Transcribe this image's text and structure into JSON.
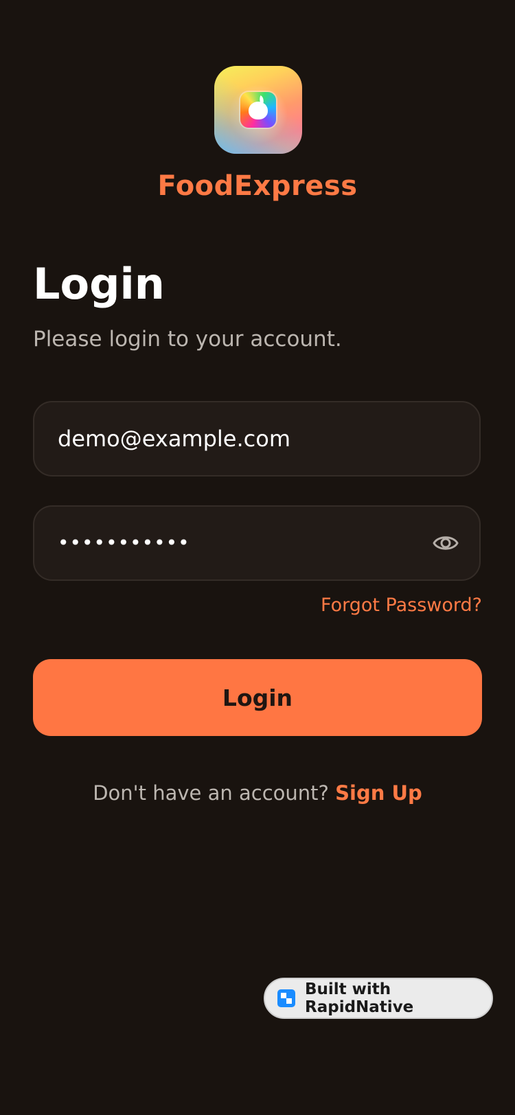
{
  "app": {
    "name": "FoodExpress",
    "logo_icon": "fruit-app-icon"
  },
  "login": {
    "title": "Login",
    "subtitle": "Please login to your account."
  },
  "form": {
    "email_value": "demo@example.com",
    "password_masked": "•••••••••••",
    "password_toggle_icon": "eye-icon",
    "forgot_password_label": "Forgot Password?",
    "submit_label": "Login"
  },
  "signup": {
    "prompt": "Don't have an account?",
    "link_label": "Sign Up"
  },
  "badge": {
    "label": "Built with RapidNative",
    "icon": "rapidnative-icon"
  },
  "colors": {
    "background": "#19130f",
    "accent": "#ff7643",
    "field_background": "#221b17",
    "muted_text": "#bcb6b0"
  }
}
